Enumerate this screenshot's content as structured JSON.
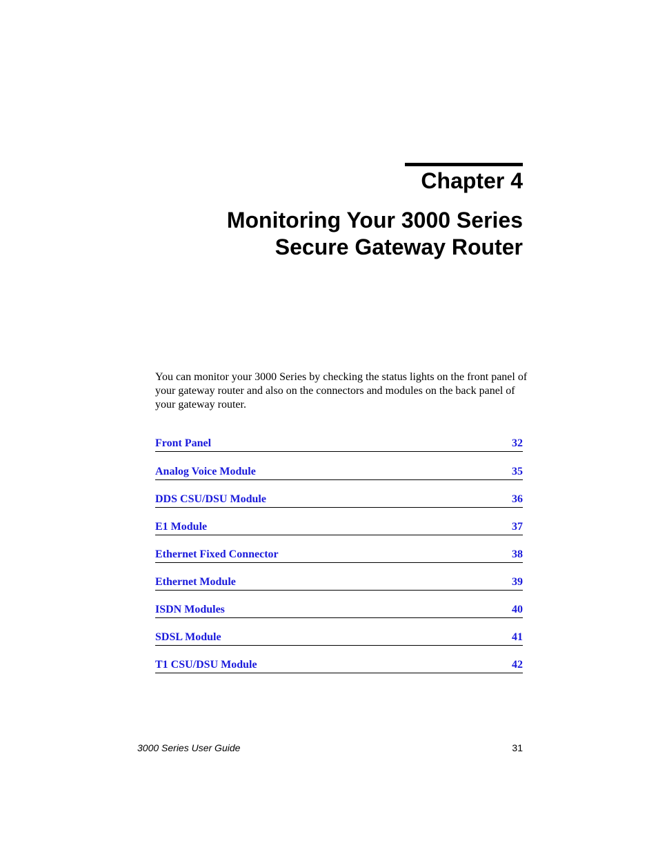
{
  "chapter": {
    "label": "Chapter 4",
    "title_lines": [
      "Monitoring Your 3000 Series",
      "Secure Gateway Router"
    ]
  },
  "intro": "You can monitor your 3000 Series by checking the status lights on the front panel of your gateway router and also on the connectors and modules on the back panel of your gateway router.",
  "toc": [
    {
      "label": "Front Panel",
      "page": "32"
    },
    {
      "label": "Analog Voice Module",
      "page": "35"
    },
    {
      "label": "DDS CSU/DSU Module",
      "page": "36"
    },
    {
      "label": "E1 Module",
      "page": "37"
    },
    {
      "label": "Ethernet Fixed Connector",
      "page": "38"
    },
    {
      "label": "Ethernet Module",
      "page": "39"
    },
    {
      "label": "ISDN Modules",
      "page": "40"
    },
    {
      "label": "SDSL Module",
      "page": "41"
    },
    {
      "label": "T1 CSU/DSU Module",
      "page": "42"
    }
  ],
  "footer": {
    "guide_title": "3000 Series User Guide",
    "page_number": "31"
  },
  "colors": {
    "link": "#1a1adb",
    "text": "#000000"
  }
}
